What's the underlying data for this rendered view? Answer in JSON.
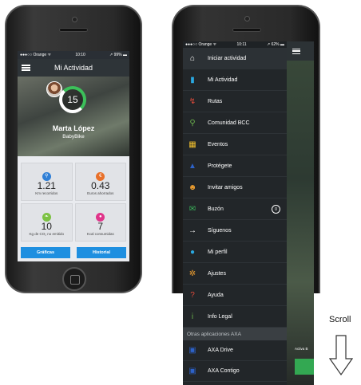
{
  "left_phone": {
    "status": {
      "carrier": "●●●○○ Orange ᯤ",
      "time": "10:10",
      "battery": "↗ 99% ▬"
    },
    "header": {
      "title": "Mi Actividad"
    },
    "profile": {
      "level": "15",
      "name": "Marta López",
      "subtitle": "BabyBike"
    },
    "stats": [
      {
        "value": "1.21",
        "label": "Km recorridos",
        "icon": "bike-icon",
        "color": "#2f7fd6"
      },
      {
        "value": "0.43",
        "label": "Euros ahorrados",
        "icon": "euro-icon",
        "color": "#e8702a"
      },
      {
        "value": "10",
        "label": "Kg de CO₂ no emitido",
        "icon": "leaf-icon",
        "color": "#7cc243"
      },
      {
        "value": "7",
        "label": "Kcal consumidas",
        "icon": "drop-icon",
        "color": "#e0348a"
      }
    ],
    "buttons": {
      "charts": "Gráficas",
      "history": "Historial"
    }
  },
  "right_phone": {
    "status": {
      "carrier": "●●●○○ Orange ᯤ",
      "time": "10:11",
      "battery": "↗ 62% ▬"
    },
    "menu": [
      {
        "label": "Iniciar actividad",
        "icon": "home-icon",
        "color": "#ffffff",
        "glyph": "⌂"
      },
      {
        "label": "Mi Actividad",
        "icon": "bar-chart-icon",
        "color": "#2aa8e0",
        "glyph": "▮"
      },
      {
        "label": "Rutas",
        "icon": "route-icon",
        "color": "#e04a3a",
        "glyph": "↯"
      },
      {
        "label": "Comunidad BCC",
        "icon": "bike-icon",
        "color": "#6ab04c",
        "glyph": "⚲"
      },
      {
        "label": "Eventos",
        "icon": "calendar-icon",
        "color": "#f2c12e",
        "glyph": "▦"
      },
      {
        "label": "Protégete",
        "icon": "axa-icon",
        "color": "#2d62c8",
        "glyph": "▲"
      },
      {
        "label": "Invitar amigos",
        "icon": "people-icon",
        "color": "#f0a030",
        "glyph": "☻"
      },
      {
        "label": "Buzón",
        "icon": "mail-icon",
        "color": "#3ab55a",
        "glyph": "✉",
        "badge": "0"
      },
      {
        "label": "Síguenos",
        "icon": "arrow-icon",
        "color": "#ffffff",
        "glyph": "→"
      },
      {
        "label": "Mi perfil",
        "icon": "person-icon",
        "color": "#2aa8e0",
        "glyph": "●"
      },
      {
        "label": "Ajustes",
        "icon": "gear-icon",
        "color": "#f0a030",
        "glyph": "✲"
      },
      {
        "label": "Ayuda",
        "icon": "question-icon",
        "color": "#e04a3a",
        "glyph": "?"
      },
      {
        "label": "Info Legal",
        "icon": "info-icon",
        "color": "#6ab04c",
        "glyph": "i"
      }
    ],
    "section_title": "Otras aplicaciones AXA",
    "other_apps": [
      {
        "label": "AXA Drive",
        "icon": "axa-drive-icon",
        "color": "#2d62c8",
        "glyph": "▣"
      },
      {
        "label": "AXA Contigo",
        "icon": "axa-contigo-icon",
        "color": "#2d62c8",
        "glyph": "▣"
      }
    ],
    "background_text": "Activa B"
  },
  "scroll_label": "Scroll"
}
